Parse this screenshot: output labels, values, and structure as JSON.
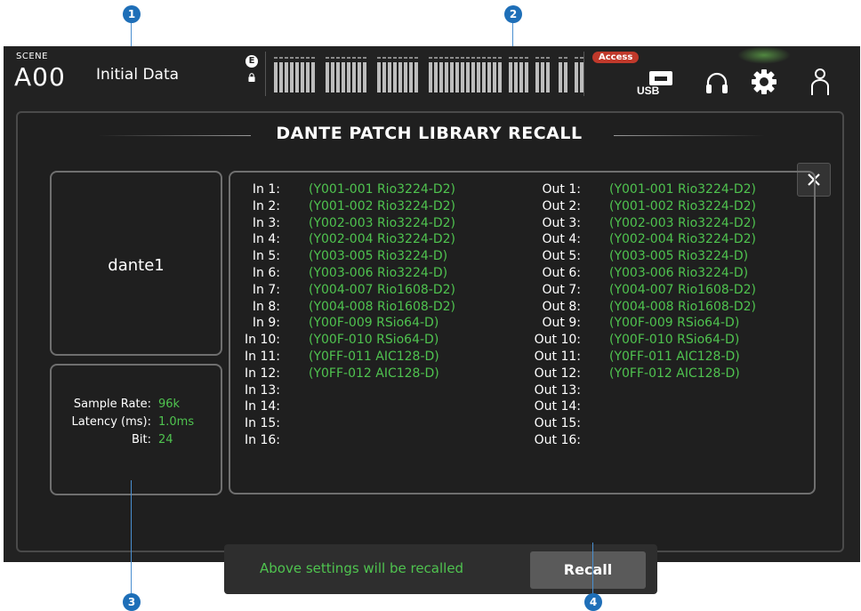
{
  "header": {
    "scene_label": "SCENE",
    "scene_number": "A00",
    "scene_title": "Initial Data",
    "e_label": "E",
    "access_badge": "Access",
    "usb_label": "USB"
  },
  "dialog": {
    "title": "DANTE PATCH LIBRARY RECALL",
    "close_label": "✕",
    "library_name": "dante1",
    "info": [
      {
        "label": "Sample Rate:",
        "value": "96k"
      },
      {
        "label": "Latency (ms):",
        "value": "1.0ms"
      },
      {
        "label": "Bit:",
        "value": "24"
      }
    ],
    "inputs": [
      {
        "ch": "In 1:",
        "device": "(Y001-001 Rio3224-D2)"
      },
      {
        "ch": "In 2:",
        "device": "(Y001-002 Rio3224-D2)"
      },
      {
        "ch": "In 3:",
        "device": "(Y002-003 Rio3224-D2)"
      },
      {
        "ch": "In 4:",
        "device": "(Y002-004 Rio3224-D2)"
      },
      {
        "ch": "In 5:",
        "device": "(Y003-005 Rio3224-D)"
      },
      {
        "ch": "In 6:",
        "device": "(Y003-006 Rio3224-D)"
      },
      {
        "ch": "In 7:",
        "device": "(Y004-007 Rio1608-D2)"
      },
      {
        "ch": "In 8:",
        "device": "(Y004-008 Rio1608-D2)"
      },
      {
        "ch": "In 9:",
        "device": "(Y00F-009 RSio64-D)"
      },
      {
        "ch": "In 10:",
        "device": "(Y00F-010 RSio64-D)"
      },
      {
        "ch": "In 11:",
        "device": "(Y0FF-011 AIC128-D)"
      },
      {
        "ch": "In 12:",
        "device": "(Y0FF-012 AIC128-D)"
      },
      {
        "ch": "In 13:",
        "device": ""
      },
      {
        "ch": "In 14:",
        "device": ""
      },
      {
        "ch": "In 15:",
        "device": ""
      },
      {
        "ch": "In 16:",
        "device": ""
      }
    ],
    "outputs": [
      {
        "ch": "Out 1:",
        "device": "(Y001-001 Rio3224-D2)"
      },
      {
        "ch": "Out 2:",
        "device": "(Y001-002 Rio3224-D2)"
      },
      {
        "ch": "Out 3:",
        "device": "(Y002-003 Rio3224-D2)"
      },
      {
        "ch": "Out 4:",
        "device": "(Y002-004 Rio3224-D2)"
      },
      {
        "ch": "Out 5:",
        "device": "(Y003-005 Rio3224-D)"
      },
      {
        "ch": "Out 6:",
        "device": "(Y003-006 Rio3224-D)"
      },
      {
        "ch": "Out 7:",
        "device": "(Y004-007 Rio1608-D2)"
      },
      {
        "ch": "Out 8:",
        "device": "(Y004-008 Rio1608-D2)"
      },
      {
        "ch": "Out 9:",
        "device": "(Y00F-009 RSio64-D)"
      },
      {
        "ch": "Out 10:",
        "device": "(Y00F-010 RSio64-D)"
      },
      {
        "ch": "Out 11:",
        "device": "(Y0FF-011 AIC128-D)"
      },
      {
        "ch": "Out 12:",
        "device": "(Y0FF-012 AIC128-D)"
      },
      {
        "ch": "Out 13:",
        "device": ""
      },
      {
        "ch": "Out 14:",
        "device": ""
      },
      {
        "ch": "Out 15:",
        "device": ""
      },
      {
        "ch": "Out 16:",
        "device": ""
      }
    ],
    "recall_message": "Above settings will be recalled",
    "recall_button": "Recall"
  },
  "callouts": [
    "1",
    "2",
    "3",
    "4"
  ],
  "colors": {
    "accent_green": "#4fc34f",
    "background": "#222222",
    "access_red": "#c0392b",
    "callout_blue": "#1e6fb8"
  },
  "icons": [
    "lock-icon",
    "usb-icon",
    "headphones-icon",
    "gear-icon",
    "user-icon",
    "close-icon"
  ]
}
